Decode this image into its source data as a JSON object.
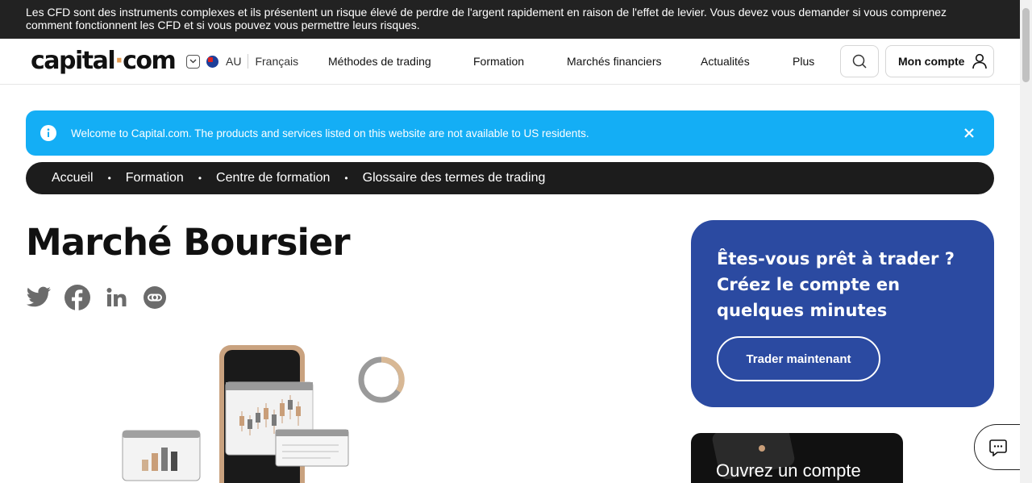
{
  "risk_warning": "Les CFD sont des instruments complexes et ils présentent un risque élevé de perdre de l'argent rapidement en raison de l'effet de levier. Vous devez vous demander si vous comprenez comment fonctionnent les CFD et si vous pouvez vous permettre leurs risques.",
  "header": {
    "logo": {
      "part1": "capital",
      "dot": "·",
      "part2": "com"
    },
    "region": "AU",
    "language": "Français",
    "nav": [
      "Méthodes de trading",
      "Formation",
      "Marchés financiers",
      "Actualités",
      "Plus"
    ],
    "account_label": "Mon compte"
  },
  "banner": {
    "text": "Welcome to Capital.com. The products and services listed on this website are not available to US residents."
  },
  "breadcrumb": [
    "Accueil",
    "Formation",
    "Centre de formation",
    "Glossaire des termes de trading"
  ],
  "page": {
    "title": "Marché Boursier"
  },
  "share_icons": [
    "twitter-icon",
    "facebook-icon",
    "linkedin-icon",
    "copy-link-icon"
  ],
  "cta": {
    "title": "Êtes-vous prêt à trader ? Créez le compte en quelques minutes",
    "button": "Trader maintenant"
  },
  "promo": {
    "title": "Ouvrez un compte"
  },
  "colors": {
    "risk_bar": "#222222",
    "banner": "#14aef5",
    "cta_card": "#2b4aa1",
    "logo_dot": "#e39a4f"
  }
}
